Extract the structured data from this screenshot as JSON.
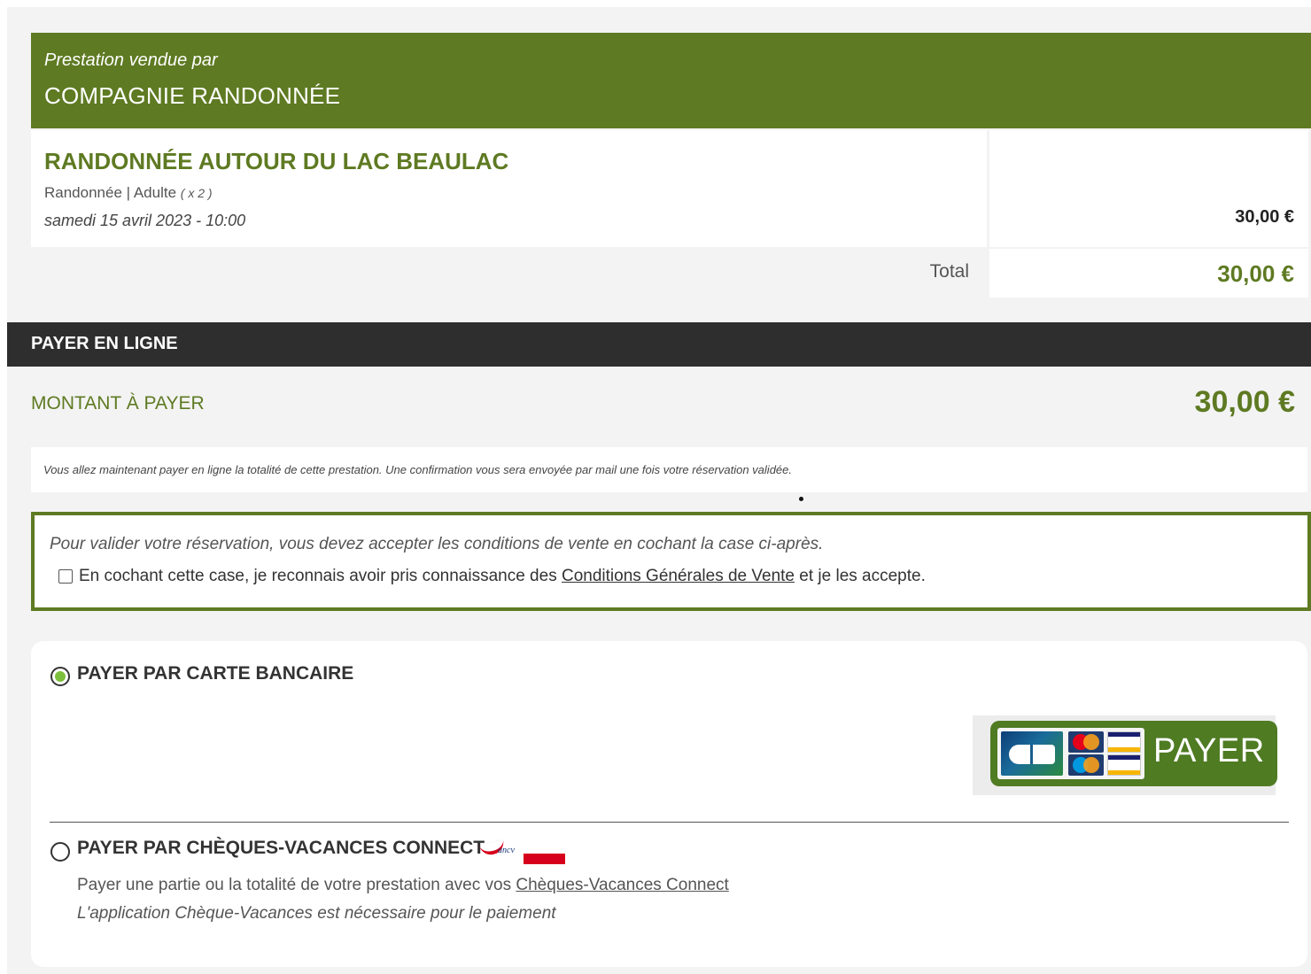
{
  "seller": {
    "subtitle": "Prestation vendue par",
    "name": "COMPAGNIE RANDONNÉE"
  },
  "item": {
    "title": "RANDONNÉE AUTOUR DU LAC BEAULAC",
    "category": "Randonnée | Adulte",
    "quantity": "( x 2 )",
    "date": "samedi 15 avril 2023 - 10:00",
    "price": "30,00 €"
  },
  "total": {
    "label": "Total",
    "value": "30,00 €"
  },
  "payment": {
    "section_title": "PAYER EN LIGNE",
    "amount_label": "MONTANT À PAYER",
    "amount_value": "30,00 €",
    "notice": "Vous allez maintenant payer en ligne la totalité de cette prestation. Une confirmation vous sera envoyée par mail une fois votre réservation validée."
  },
  "cgv": {
    "intro": "Pour valider votre réservation, vous devez accepter les conditions de vente en cochant la case ci-après.",
    "checkbox_before": "En cochant cette case, je reconnais avoir pris connaissance des",
    "link": "Conditions Générales de Vente",
    "checkbox_after": "et je les accepte.",
    "checked": false
  },
  "methods": {
    "card": {
      "label": "PAYER PAR CARTE BANCAIRE",
      "selected": true,
      "button_label": "PAYER",
      "icons": [
        "cb-icon",
        "mastercard-icon",
        "visa-icon",
        "maestro-icon",
        "visa-electron-icon"
      ]
    },
    "ancv": {
      "label": "PAYER PAR CHÈQUES-VACANCES CONNECT",
      "selected": false,
      "logo_text": "ancv",
      "desc_before": "Payer une partie ou la totalité de votre prestation avec vos",
      "desc_link": "Chèques-Vacances Connect",
      "note": "L'application Chèque-Vacances est nécessaire pour le paiement"
    }
  },
  "colors": {
    "brand_green": "#5e7a22",
    "dark_bar": "#2e2e2e",
    "radio_on": "#7cbf3c"
  }
}
